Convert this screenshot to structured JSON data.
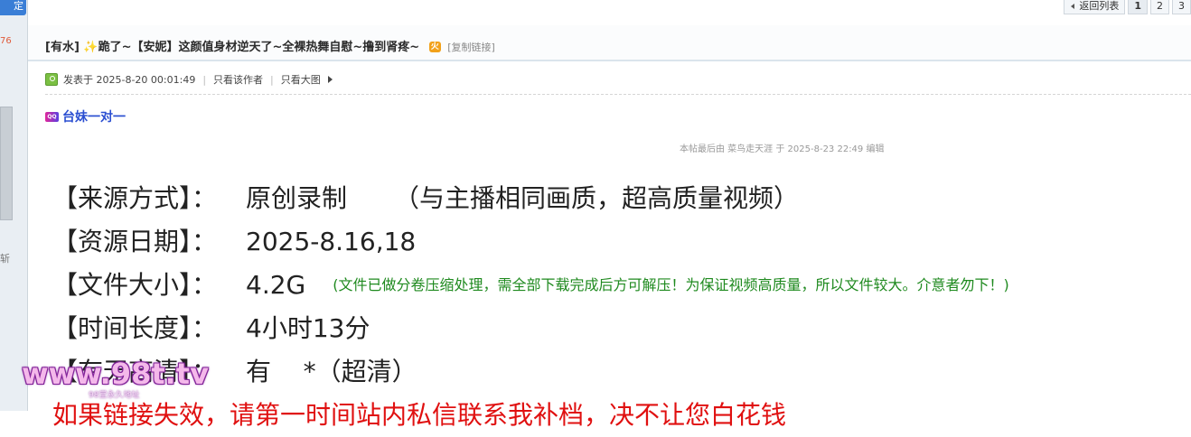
{
  "left": {
    "top_button_label": "定",
    "reply_count": "76",
    "side_char": "斩"
  },
  "pager": {
    "back_label": "返回列表",
    "pages": [
      "1",
      "2",
      "3"
    ],
    "current": "1"
  },
  "thread": {
    "category": "[有水]",
    "spark_icon": "✨",
    "title": "跪了~【安妮】这颜值身材逆天了~全裸热舞自慰~撸到肾疼~",
    "hot_badge": "火",
    "copy_link": "[复制链接]"
  },
  "meta": {
    "posted_at": "发表于 2025-8-20 00:01:49",
    "only_author": "只看该作者",
    "only_images": "只看大图"
  },
  "tag": {
    "icon_text": "QQ",
    "label": "台妹一对一"
  },
  "edit_note": "本帖最后由 菜鸟走天涯 于 2025-8-23 22:49 编辑",
  "content": {
    "source_label": "【来源方式】：",
    "source_value": "原创录制",
    "source_note": "（与主播相同画质，超高质量视频）",
    "date_label": "【资源日期】：",
    "date_value": "2025-8.16,18",
    "size_label": "【文件大小】：",
    "size_value": "4.2G",
    "size_note": "(文件已做分卷压缩处理，需全部下载完成后方可解压！为保证视频高质量，所以文件较大。介意者勿下！)",
    "duration_label": "【时间长度】：",
    "duration_value": "4小时13分",
    "extra_label": "【有无高清】：",
    "extra_value": "有    *（超清）",
    "warning": "如果链接失效，请第一时间站内私信联系我补档，决不让您白花钱"
  },
  "watermark": {
    "text": "www.98t.tv",
    "sub": "98堂永久地址"
  }
}
